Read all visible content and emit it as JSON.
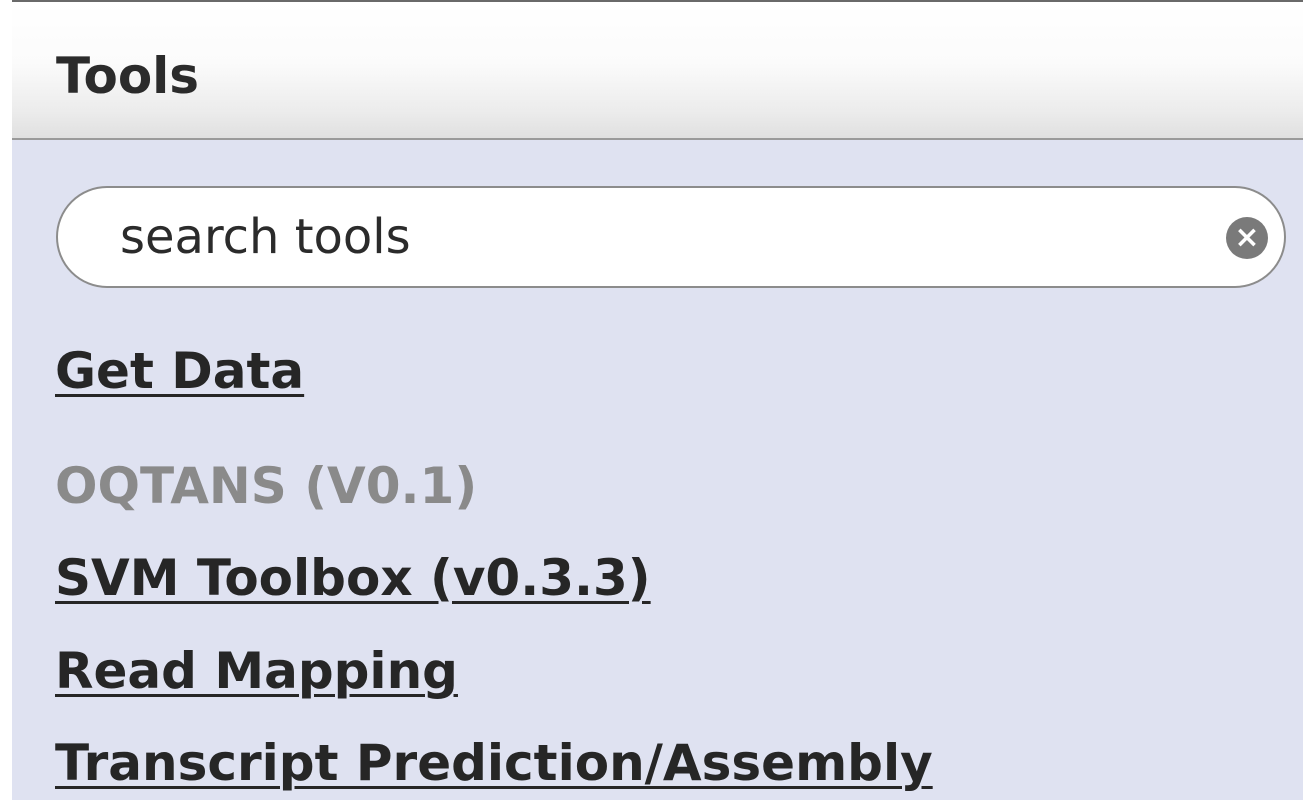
{
  "panel": {
    "title": "Tools"
  },
  "search": {
    "placeholder": "search tools",
    "value": "",
    "clear_icon": "clear-icon"
  },
  "tool_sections": [
    {
      "label": "Get Data",
      "link": true
    },
    {
      "label": "OQTANS (V0.1)",
      "link": false
    },
    {
      "label": "SVM Toolbox (v0.3.3)",
      "link": true
    },
    {
      "label": "Read Mapping",
      "link": true
    },
    {
      "label": "Transcript Prediction/Assembly",
      "link": true
    }
  ],
  "colors": {
    "panel_background": "#dfe2f1",
    "link_text": "#262626",
    "disabled_text": "#8a8a8a"
  }
}
